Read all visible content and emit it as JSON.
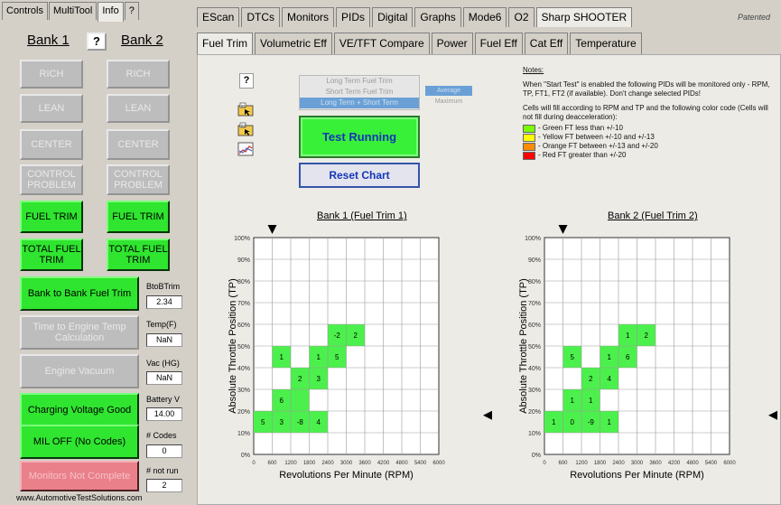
{
  "left": {
    "tabs": [
      "Controls",
      "MultiTool",
      "Info",
      "?"
    ],
    "bank1": "Bank 1",
    "bank2": "Bank 2",
    "help": "?",
    "rows": [
      {
        "b1": "RICH",
        "b2": "RICH",
        "style": "grey"
      },
      {
        "b1": "LEAN",
        "b2": "LEAN",
        "style": "grey"
      },
      {
        "b1": "CENTER",
        "b2": "CENTER",
        "style": "grey"
      },
      {
        "b1": "CONTROL PROBLEM",
        "b2": "CONTROL PROBLEM",
        "style": "grey"
      },
      {
        "b1": "FUEL TRIM",
        "b2": "FUEL TRIM",
        "style": "green"
      },
      {
        "b1": "TOTAL FUEL TRIM",
        "b2": "TOTAL FUEL TRIM",
        "style": "green"
      }
    ],
    "items": [
      {
        "label": "Bank to Bank Fuel Trim",
        "style": "green",
        "side_label": "BtoBTrim",
        "side_value": "2.34"
      },
      {
        "label": "Time to Engine Temp Calculation",
        "style": "grey",
        "side_label": "Temp(F)",
        "side_value": "NaN"
      },
      {
        "label": "Engine Vacuum",
        "style": "grey",
        "side_label": "Vac (HG)",
        "side_value": "NaN"
      },
      {
        "label": "Charging Voltage Good",
        "style": "green",
        "side_label": "Battery V",
        "side_value": "14.00"
      },
      {
        "label": "MIL OFF (No Codes)",
        "style": "green",
        "side_label": "# Codes",
        "side_value": "0"
      },
      {
        "label": "Monitors Not Complete",
        "style": "red",
        "side_label": "# not run",
        "side_value": "2"
      }
    ],
    "footer": "www.AutomotiveTestSolutions.com"
  },
  "top_tabs": [
    "EScan",
    "DTCs",
    "Monitors",
    "PIDs",
    "Digital",
    "Graphs",
    "Mode6",
    "O2",
    "Sharp SHOOTER"
  ],
  "patented": "Patented",
  "sub_tabs": [
    "Fuel Trim",
    "Volumetric Eff",
    "VE/TFT Compare",
    "Power",
    "Fuel Eff",
    "Cat Eff",
    "Temperature"
  ],
  "active_sub_tab": 0,
  "controls": {
    "help": "?",
    "trim_options": [
      "Long Term Fuel Trim",
      "Short Term Fuel Trim",
      "Long Term + Short Term"
    ],
    "selected_option": 2,
    "mode_buttons": [
      "Average",
      "Maximum"
    ],
    "test_button": "Test Running",
    "reset_button": "Reset Chart"
  },
  "notes": {
    "header": "Notes:",
    "p1": "When \"Start Test\" is enabled the following PIDs will be monitored only - RPM, TP, FT1, FT2 (if available). Don't change selected PIDs!",
    "p2": "Cells will fill according to RPM and TP and the following color code (Cells will not fill during deacceleration):",
    "legend": [
      {
        "color": "#7cfc00",
        "text": "- Green   FT less than +/-10"
      },
      {
        "color": "#ffff00",
        "text": "- Yellow  FT between +/-10 and +/-13"
      },
      {
        "color": "#ff8c00",
        "text": "- Orange  FT between +/-13 and +/-20"
      },
      {
        "color": "#ff0000",
        "text": "- Red       FT greater than +/-20"
      }
    ]
  },
  "chart_data": [
    {
      "type": "heatmap",
      "title": "Bank 1 (Fuel Trim 1)",
      "xlabel": "Revolutions Per Minute (RPM)",
      "ylabel": "Absolute Throttle Position (TP)",
      "x_ticks": [
        "0",
        "600",
        "1200",
        "1800",
        "2400",
        "3000",
        "3600",
        "4200",
        "4800",
        "5400",
        "6000"
      ],
      "y_ticks": [
        "0%",
        "10%",
        "20%",
        "30%",
        "40%",
        "50%",
        "60%",
        "70%",
        "80%",
        "90%",
        "100%"
      ],
      "cells": [
        {
          "col": 0,
          "row": 1,
          "value": "5"
        },
        {
          "col": 1,
          "row": 1,
          "value": "3"
        },
        {
          "col": 2,
          "row": 1,
          "value": "-8"
        },
        {
          "col": 3,
          "row": 1,
          "value": "4"
        },
        {
          "col": 1,
          "row": 2,
          "value": "6"
        },
        {
          "col": 2,
          "row": 2,
          "value": ""
        },
        {
          "col": 2,
          "row": 3,
          "value": "2"
        },
        {
          "col": 3,
          "row": 3,
          "value": "3"
        },
        {
          "col": 1,
          "row": 4,
          "value": "1"
        },
        {
          "col": 3,
          "row": 4,
          "value": "1"
        },
        {
          "col": 4,
          "row": 4,
          "value": "5"
        },
        {
          "col": 4,
          "row": 5,
          "value": "-2"
        },
        {
          "col": 5,
          "row": 5,
          "value": "2"
        }
      ]
    },
    {
      "type": "heatmap",
      "title": "Bank 2 (Fuel Trim 2)",
      "xlabel": "Revolutions Per Minute (RPM)",
      "ylabel": "Absolute Throttle Position (TP)",
      "x_ticks": [
        "0",
        "600",
        "1200",
        "1800",
        "2400",
        "3000",
        "3600",
        "4200",
        "4800",
        "5400",
        "6000"
      ],
      "y_ticks": [
        "0%",
        "10%",
        "20%",
        "30%",
        "40%",
        "50%",
        "60%",
        "70%",
        "80%",
        "90%",
        "100%"
      ],
      "cells": [
        {
          "col": 0,
          "row": 1,
          "value": "1"
        },
        {
          "col": 1,
          "row": 1,
          "value": "0"
        },
        {
          "col": 2,
          "row": 1,
          "value": "-9"
        },
        {
          "col": 3,
          "row": 1,
          "value": "1"
        },
        {
          "col": 1,
          "row": 2,
          "value": "1"
        },
        {
          "col": 2,
          "row": 2,
          "value": "1"
        },
        {
          "col": 2,
          "row": 3,
          "value": "2"
        },
        {
          "col": 3,
          "row": 3,
          "value": "4"
        },
        {
          "col": 1,
          "row": 4,
          "value": "5"
        },
        {
          "col": 3,
          "row": 4,
          "value": "1"
        },
        {
          "col": 4,
          "row": 4,
          "value": "6"
        },
        {
          "col": 4,
          "row": 5,
          "value": "1"
        },
        {
          "col": 5,
          "row": 5,
          "value": "2"
        }
      ]
    }
  ],
  "cell_color": "#4cf04c"
}
